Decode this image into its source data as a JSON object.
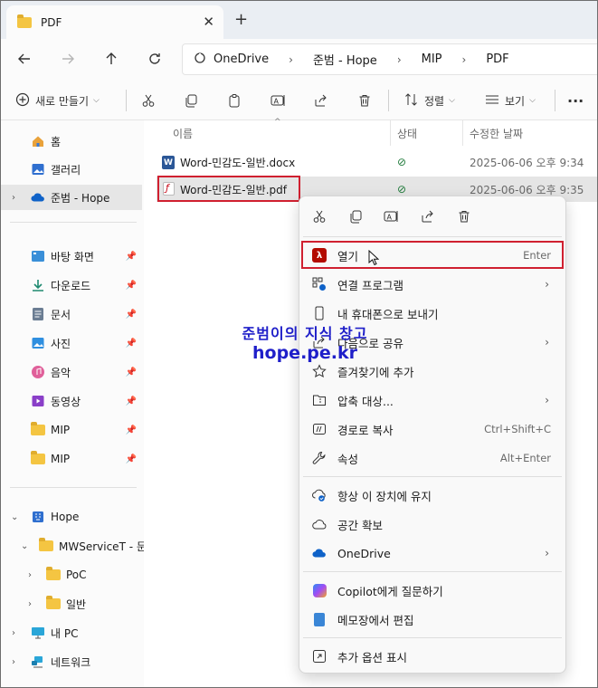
{
  "window": {
    "tab_title": "PDF",
    "tab_close": "✕",
    "new_tab": "+"
  },
  "breadcrumb": {
    "items": [
      "OneDrive",
      "준범 - Hope",
      "MIP",
      "PDF"
    ],
    "separator": "›"
  },
  "toolbar": {
    "new_label": "새로 만들기",
    "sort_label": "정렬",
    "view_label": "보기",
    "more_label": "···"
  },
  "sidebar": {
    "quick": [
      {
        "label": "홈",
        "icon": "home-icon"
      },
      {
        "label": "갤러리",
        "icon": "gallery-icon"
      },
      {
        "label": "준범 - Hope",
        "icon": "onedrive-cloud-icon"
      }
    ],
    "pinned": [
      {
        "label": "바탕 화면",
        "icon": "desktop-icon"
      },
      {
        "label": "다운로드",
        "icon": "download-icon"
      },
      {
        "label": "문서",
        "icon": "documents-icon"
      },
      {
        "label": "사진",
        "icon": "pictures-icon"
      },
      {
        "label": "음악",
        "icon": "music-icon"
      },
      {
        "label": "동영상",
        "icon": "videos-icon"
      },
      {
        "label": "MIP",
        "icon": "folder-icon"
      },
      {
        "label": "MIP",
        "icon": "folder-icon"
      }
    ],
    "tree": [
      {
        "label": "Hope",
        "icon": "building-icon"
      },
      {
        "label": "MWServiceT - 문서",
        "icon": "folder-icon"
      },
      {
        "label": "PoC",
        "icon": "folder-icon"
      },
      {
        "label": "일반",
        "icon": "folder-icon"
      },
      {
        "label": "내 PC",
        "icon": "pc-icon"
      },
      {
        "label": "네트워크",
        "icon": "network-icon"
      }
    ]
  },
  "filelist": {
    "columns": [
      "이름",
      "상태",
      "수정한 날짜"
    ],
    "rows": [
      {
        "name": "Word-민감도-일반.docx",
        "status": "⊘",
        "date": "2025-06-06 오후 9:34",
        "type": "docx"
      },
      {
        "name": "Word-민감도-일반.pdf",
        "status": "⊘",
        "date": "2025-06-06 오후 9:35",
        "type": "pdf"
      }
    ]
  },
  "context_menu": {
    "items": [
      {
        "label": "열기",
        "shortcut": "Enter",
        "icon": "acrobat-icon"
      },
      {
        "label": "연결 프로그램",
        "submenu": "›",
        "icon": "open-with-icon"
      },
      {
        "label": "내 휴대폰으로 보내기",
        "icon": "phone-icon"
      },
      {
        "label": "다음으로 공유",
        "submenu": "›",
        "icon": "share-icon"
      },
      {
        "label": "즐겨찾기에 추가",
        "icon": "star-icon"
      },
      {
        "label": "압축 대상...",
        "submenu": "›",
        "icon": "archive-icon"
      },
      {
        "label": "경로로 복사",
        "shortcut": "Ctrl+Shift+C",
        "icon": "copy-path-icon"
      },
      {
        "label": "속성",
        "shortcut": "Alt+Enter",
        "icon": "wrench-icon"
      },
      {
        "label": "항상 이 장치에 유지",
        "icon": "keep-device-icon"
      },
      {
        "label": "공간 확보",
        "icon": "cloud-icon"
      },
      {
        "label": "OneDrive",
        "submenu": "›",
        "icon": "onedrive-icon"
      },
      {
        "label": "Copilot에게 질문하기",
        "icon": "copilot-icon"
      },
      {
        "label": "메모장에서 편집",
        "icon": "notepad-icon"
      },
      {
        "label": "추가 옵션 표시",
        "icon": "more-options-icon"
      }
    ]
  },
  "watermark": {
    "line1": "준범이의 지식 창고",
    "line2": "hope.pe.kr"
  },
  "colors": {
    "highlight": "#d02030",
    "accent": "#0067c0",
    "watermark": "#1f1fc9"
  }
}
